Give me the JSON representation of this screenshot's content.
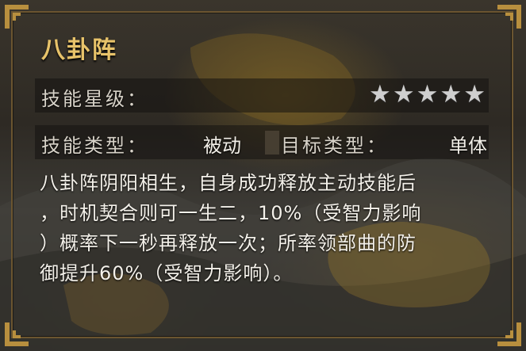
{
  "skill": {
    "name": "八卦阵",
    "star_label": "技能星级：",
    "stars_total": 5,
    "stars_filled": 0,
    "star_glyph": "★",
    "type_label": "技能类型：",
    "type_value": "被动",
    "target_label": "目标类型：",
    "target_value": "单体",
    "description_lines": [
      "八卦阵阴阳相生，自身成功释放主动技能后",
      "，时机契合则可一生二，10%（受智力影响",
      "）概率下一秒再释放一次；所率领部曲的防",
      "御提升60%（受智力影响）。"
    ]
  },
  "colors": {
    "title": "#e8c36a",
    "frame": "#6b5530",
    "star_empty": "#cfcfcf"
  },
  "icons": [
    "corner-ornament-icon",
    "star-icon"
  ]
}
